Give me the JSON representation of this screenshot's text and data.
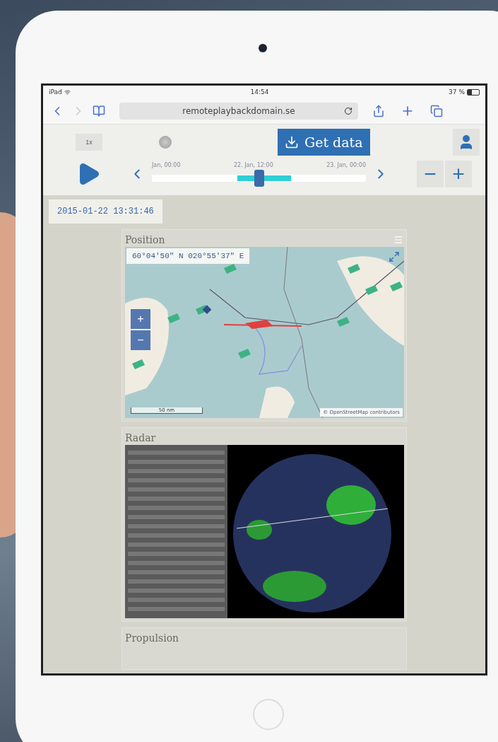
{
  "status_bar": {
    "device": "iPad",
    "time": "14:54",
    "battery": "37 %"
  },
  "browser": {
    "url": "remoteplaybackdomain.se"
  },
  "toolbar": {
    "speed": "1x",
    "get_data": "Get data",
    "timeline": {
      "labels": [
        "Jan, 00:00",
        "22. Jan, 12:00",
        "23. Jan, 00:00"
      ],
      "level": 0.5
    },
    "zoom_out": "−",
    "zoom_in": "+"
  },
  "timestamp": "2015-01-22 13:31:46",
  "panels": [
    {
      "kind": "map",
      "title": "Position",
      "coordinates": "60°04'50\" N 020°55'37\" E",
      "zoom_in": "+",
      "zoom_out": "−",
      "scale": "50 nm",
      "attribution": "© OpenStreetMap contributors"
    },
    {
      "kind": "radar",
      "title": "Radar"
    },
    {
      "kind": "empty",
      "title": "Propulsion"
    }
  ]
}
